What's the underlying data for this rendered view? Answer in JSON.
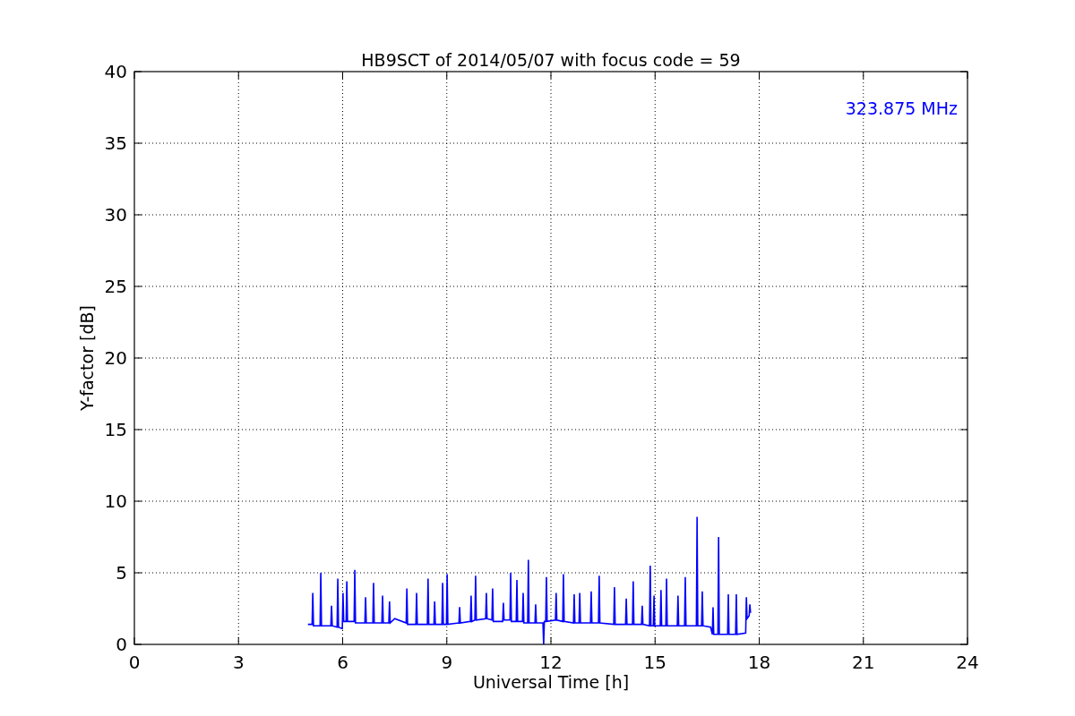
{
  "figure": {
    "chart_data": {
      "type": "line",
      "title": "HB9SCT of 2014/05/07 with focus code = 59",
      "xlabel": "Universal Time [h]",
      "ylabel": "Y-factor [dB]",
      "xlim": [
        0,
        24
      ],
      "ylim": [
        0,
        40
      ],
      "xticks": [
        0,
        3,
        6,
        9,
        12,
        15,
        18,
        21,
        24
      ],
      "yticks": [
        0,
        5,
        10,
        15,
        20,
        25,
        30,
        35,
        40
      ],
      "grid": true,
      "x": [
        5.0,
        5.12,
        5.14,
        5.16,
        5.35,
        5.37,
        5.39,
        5.66,
        5.68,
        5.7,
        5.84,
        5.86,
        5.88,
        5.99,
        6.01,
        6.03,
        6.1,
        6.12,
        6.14,
        6.33,
        6.35,
        6.37,
        6.64,
        6.66,
        6.68,
        6.87,
        6.89,
        6.91,
        7.13,
        7.15,
        7.17,
        7.33,
        7.35,
        7.37,
        7.5,
        7.83,
        7.85,
        7.87,
        8.11,
        8.13,
        8.15,
        8.44,
        8.46,
        8.48,
        8.63,
        8.65,
        8.67,
        8.86,
        8.88,
        8.9,
        8.99,
        9.01,
        9.03,
        9.35,
        9.37,
        9.39,
        9.68,
        9.7,
        9.72,
        9.81,
        9.83,
        9.85,
        10.12,
        10.14,
        10.16,
        10.3,
        10.32,
        10.34,
        10.61,
        10.63,
        10.65,
        10.82,
        10.84,
        10.86,
        11.0,
        11.02,
        11.04,
        11.18,
        11.2,
        11.22,
        11.33,
        11.35,
        11.37,
        11.54,
        11.56,
        11.58,
        11.77,
        11.79,
        11.81,
        11.85,
        11.87,
        11.89,
        12.13,
        12.15,
        12.17,
        12.34,
        12.36,
        12.38,
        12.65,
        12.67,
        12.69,
        12.81,
        12.83,
        12.85,
        13.14,
        13.16,
        13.18,
        13.37,
        13.39,
        13.41,
        13.81,
        13.83,
        13.85,
        14.15,
        14.17,
        14.19,
        14.35,
        14.37,
        14.39,
        14.61,
        14.63,
        14.65,
        14.84,
        14.86,
        14.88,
        14.95,
        14.97,
        14.99,
        15.15,
        15.17,
        15.19,
        15.31,
        15.33,
        15.35,
        15.64,
        15.66,
        15.68,
        15.85,
        15.87,
        15.89,
        16.19,
        16.21,
        16.23,
        16.34,
        16.36,
        16.38,
        16.6,
        16.65,
        16.67,
        16.69,
        16.81,
        16.83,
        16.85,
        17.09,
        17.11,
        17.13,
        17.32,
        17.34,
        17.36,
        17.61,
        17.63,
        17.65,
        17.71,
        17.73,
        17.75
      ],
      "series": [
        {
          "name": "323.875 MHz",
          "color": "#0000ff",
          "values": [
            1.4,
            1.4,
            3.6,
            1.3,
            1.3,
            5.0,
            1.3,
            1.3,
            2.7,
            1.3,
            1.2,
            4.6,
            1.2,
            1.1,
            3.6,
            1.6,
            1.6,
            4.4,
            1.6,
            1.6,
            5.2,
            1.5,
            1.5,
            3.3,
            1.5,
            1.5,
            4.3,
            1.5,
            1.5,
            3.4,
            1.5,
            1.5,
            3.0,
            1.5,
            1.8,
            1.5,
            3.9,
            1.4,
            1.4,
            3.6,
            1.4,
            1.4,
            4.6,
            1.4,
            1.4,
            3.0,
            1.4,
            1.4,
            4.3,
            1.4,
            1.4,
            4.9,
            1.4,
            1.5,
            2.6,
            1.5,
            1.6,
            3.4,
            1.6,
            1.7,
            4.8,
            1.7,
            1.8,
            3.6,
            1.8,
            1.7,
            3.9,
            1.6,
            1.6,
            2.9,
            1.7,
            1.7,
            5.0,
            1.6,
            1.6,
            4.5,
            1.6,
            1.6,
            3.6,
            1.5,
            1.5,
            5.9,
            1.5,
            1.5,
            2.8,
            1.5,
            1.5,
            0.0,
            1.6,
            1.6,
            4.7,
            1.6,
            1.7,
            3.6,
            1.7,
            1.6,
            4.9,
            1.6,
            1.5,
            3.5,
            1.5,
            1.5,
            3.6,
            1.5,
            1.5,
            3.7,
            1.5,
            1.5,
            4.8,
            1.5,
            1.4,
            4.0,
            1.4,
            1.4,
            3.2,
            1.4,
            1.4,
            4.4,
            1.4,
            1.4,
            2.7,
            1.4,
            1.3,
            5.5,
            1.3,
            1.3,
            3.4,
            1.3,
            1.3,
            3.8,
            1.3,
            1.3,
            4.6,
            1.3,
            1.3,
            3.4,
            1.3,
            1.3,
            4.7,
            1.3,
            1.3,
            8.9,
            1.3,
            1.3,
            3.7,
            1.3,
            1.2,
            0.7,
            2.6,
            0.7,
            0.7,
            7.5,
            0.7,
            0.7,
            3.5,
            0.7,
            0.7,
            3.5,
            0.7,
            0.8,
            3.3,
            1.8,
            2.0,
            2.8,
            2.2
          ]
        }
      ]
    }
  }
}
